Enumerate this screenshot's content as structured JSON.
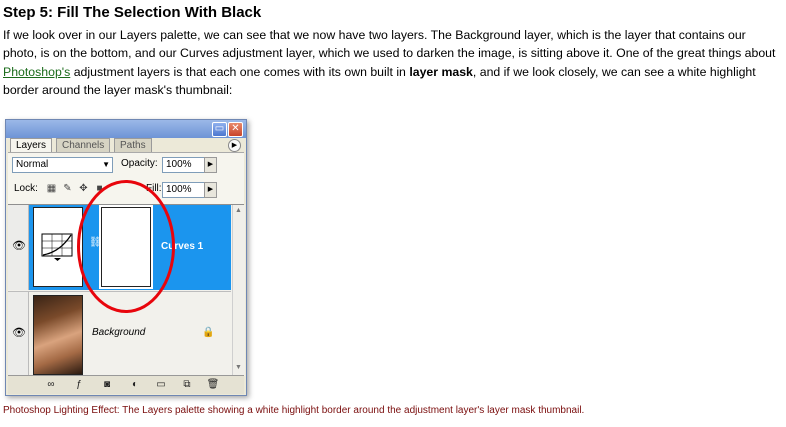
{
  "article": {
    "heading": "Step 5: Fill The Selection With Black",
    "para_part1": "If we look over in our Layers palette, we can see that we now have two layers. The Background layer, which is the layer that contains our photo, is on the bottom, and our Curves adjustment layer, which we used to darken the image, is sitting above it. One of the great things about ",
    "link_text": "Photoshop's",
    "para_part2": " adjustment layers is that each one comes with its own built in ",
    "bold_text": "layer mask",
    "para_part3": ", and if we look closely, we can see a white highlight border around the layer mask's thumbnail:",
    "caption": "Photoshop Lighting Effect: The Layers palette showing a white highlight border around the adjustment layer's layer mask thumbnail."
  },
  "palette": {
    "tabs": [
      "Layers",
      "Channels",
      "Paths"
    ],
    "active_tab": "Layers",
    "blend_mode": "Normal",
    "opacity_label": "Opacity:",
    "opacity_value": "100%",
    "lock_label": "Lock:",
    "fill_label": "Fill:",
    "fill_value": "100%",
    "layers": [
      {
        "name": "Curves 1",
        "selected": true,
        "visible": true
      },
      {
        "name": "Background",
        "selected": false,
        "visible": true,
        "locked": true
      }
    ]
  },
  "colors": {
    "selected_row": "#1b95ee",
    "highlight_circle": "#e8050c",
    "link": "#1a6b1a",
    "caption": "#7a0d0d"
  },
  "icons": [
    "minimize-icon",
    "close-icon",
    "palette-menu-icon",
    "eye-icon",
    "chain-icon",
    "lock-icon",
    "link-layers-icon",
    "layer-style-icon",
    "add-mask-icon",
    "adjustment-layer-icon",
    "new-group-icon",
    "new-layer-icon",
    "trash-icon"
  ]
}
